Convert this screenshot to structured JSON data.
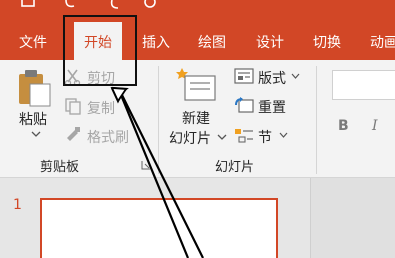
{
  "tabs": [
    {
      "label": "文件"
    },
    {
      "label": "开始",
      "active": true
    },
    {
      "label": "插入"
    },
    {
      "label": "绘图"
    },
    {
      "label": "设计"
    },
    {
      "label": "切换"
    },
    {
      "label": "动画"
    }
  ],
  "clipboard": {
    "paste_label": "粘贴",
    "cut_label": "剪切",
    "copy_label": "复制",
    "format_painter_label": "格式刷",
    "group_label": "剪贴板"
  },
  "slides": {
    "new_slide_line1": "新建",
    "new_slide_line2": "幻灯片",
    "layout_label": "版式",
    "reset_label": "重置",
    "section_label": "节",
    "group_label": "幻灯片"
  },
  "font": {
    "bold_label": "B",
    "italic_label": "I"
  },
  "thumbnail": {
    "slide_number": "1"
  },
  "colors": {
    "accent": "#d24726",
    "ribbon_bg": "#f3f3f3"
  }
}
